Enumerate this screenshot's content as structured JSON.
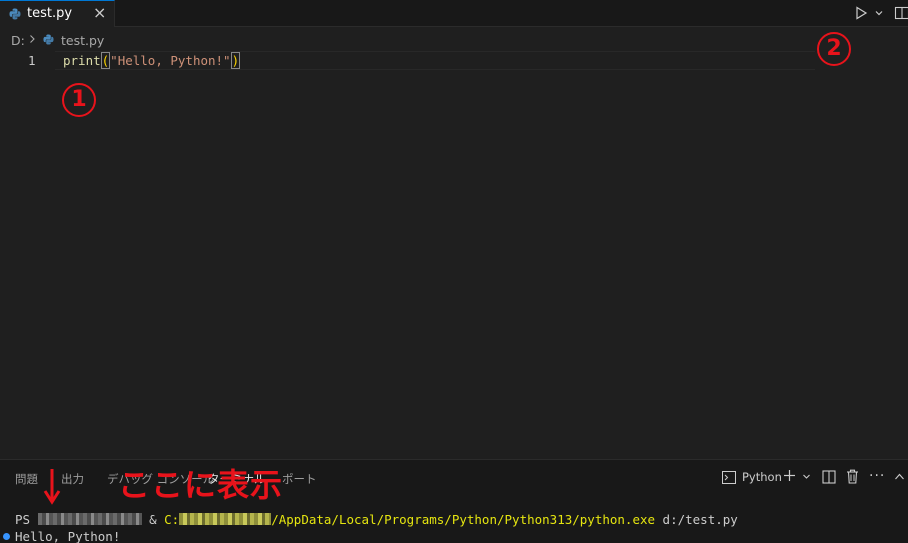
{
  "tab": {
    "label": "test.py",
    "close_glyph": "×",
    "icon": "python-icon"
  },
  "breadcrumb": {
    "drive": "D:",
    "file": "test.py"
  },
  "editor": {
    "line_number": "1",
    "code": {
      "fn": "print",
      "open": "(",
      "str": "\"Hello, Python!\"",
      "close": ")"
    }
  },
  "annotations": {
    "circle_1": "1",
    "circle_2": "2",
    "arrow": "↓",
    "caption": "ここに表示",
    "color": "#e8131b"
  },
  "panel": {
    "tabs": [
      "問題",
      "出力",
      "デバッグ コンソール",
      "ターミナル",
      "ポート"
    ],
    "terminal_name": "Python",
    "more": "···"
  },
  "terminal": {
    "prompt": "PS ",
    "amp": " & ",
    "drive_prefix": "C:",
    "path_rest": "/AppData/Local/Programs/Python/Python313/python.exe",
    "arg": " d:/test.py",
    "output": "Hello, Python!"
  },
  "colors": {
    "accent": "#0078d4",
    "editor_bg": "#1f1f1f",
    "panel_bg": "#181818",
    "function": "#dcdcaa",
    "string": "#ce9178",
    "bracket": "#ffd700",
    "terminal_yellow": "#e5e510",
    "status_dot": "#3794ff"
  }
}
